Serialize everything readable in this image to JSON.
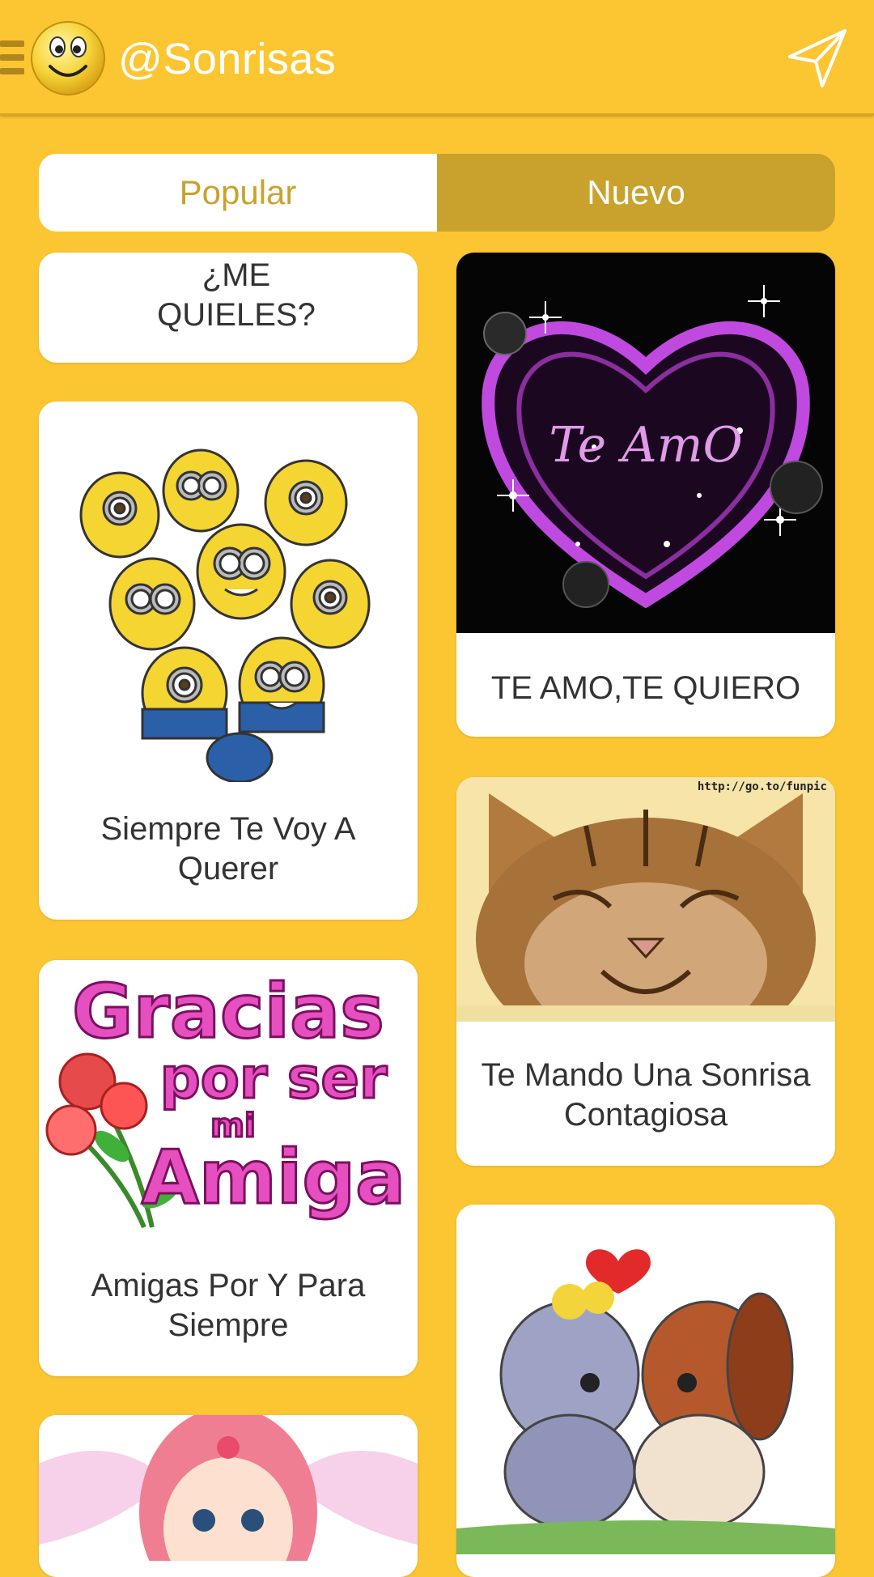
{
  "appbar": {
    "title": "@Sonrisas"
  },
  "tabs": {
    "popular": "Popular",
    "nuevo": "Nuevo"
  },
  "cards": {
    "quieles": {
      "caption": "¿ME QUIELES?"
    },
    "siempre": {
      "caption": "Siempre Te Voy A Querer"
    },
    "amigas": {
      "caption": "Amigas Por Y Para Siempre",
      "image_text": "Gracias por ser mi Amiga"
    },
    "teamo": {
      "caption": "TE AMO,TE QUIERO",
      "image_text": "Te AmO"
    },
    "sonrisa": {
      "caption": "Te Mando Una Sonrisa Contagiosa",
      "image_text": "http://go.to/funpic"
    }
  },
  "colors": {
    "background": "#fcc633",
    "accent": "#c9a22e",
    "card": "#ffffff"
  },
  "icons": {
    "menu": "menu-icon",
    "logo": "smiley-icon",
    "send": "send-icon"
  }
}
